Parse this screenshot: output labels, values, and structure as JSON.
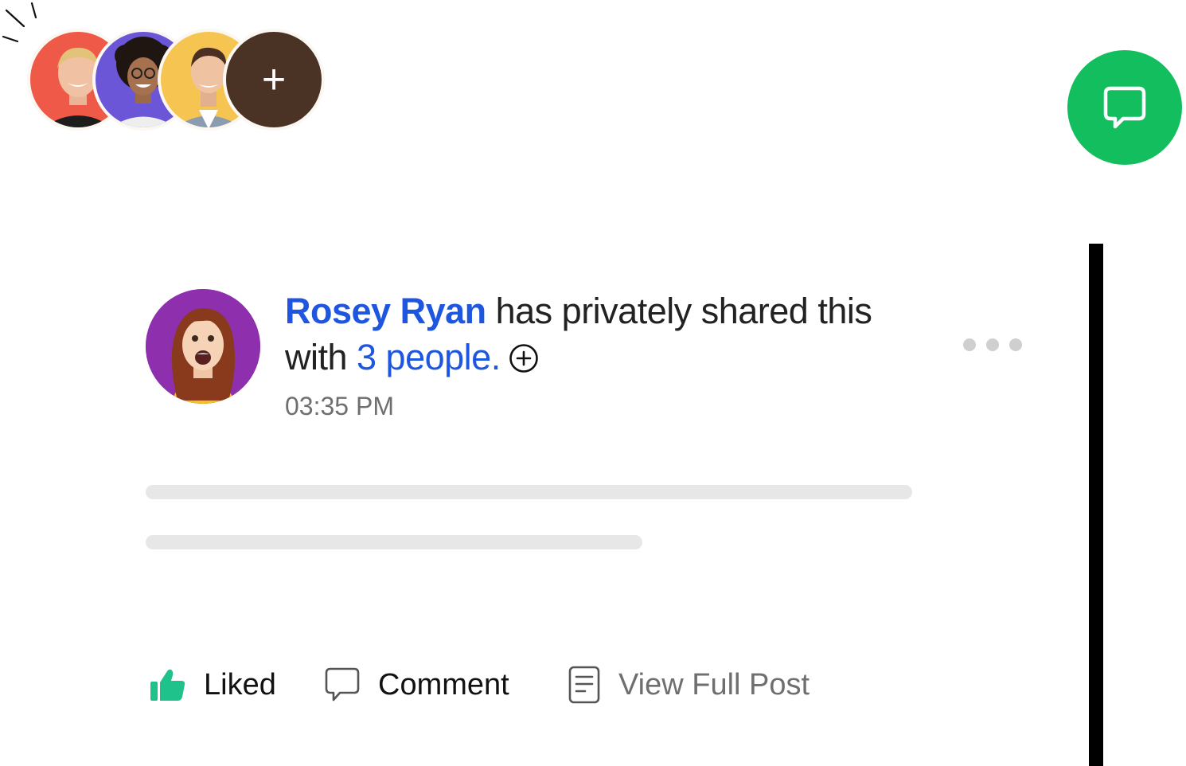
{
  "participants": {
    "avatars": [
      {
        "name": "participant-avatar-1",
        "bg": "#ef5a48"
      },
      {
        "name": "participant-avatar-2",
        "bg": "#6a56d6"
      },
      {
        "name": "participant-avatar-3",
        "bg": "#f6c451"
      }
    ],
    "add_label": "+",
    "add_bg": "#4a3224"
  },
  "chat_fab": {
    "icon": "chat-bubble-icon",
    "color": "#12be5d"
  },
  "post": {
    "author": "Rosey Ryan",
    "action_text": " has privately shared this with ",
    "people_link": "3 people.",
    "add_people_icon": "plus-circle-icon",
    "timestamp": "03:35 PM",
    "more_icon": "more-horizontal-icon",
    "link_color": "#1f56e0"
  },
  "actions": {
    "like": {
      "label": "Liked",
      "icon": "thumbs-up-icon",
      "color": "#1fc28a"
    },
    "comment": {
      "label": "Comment",
      "icon": "comment-icon"
    },
    "view_full": {
      "label": "View Full Post",
      "icon": "document-icon"
    }
  }
}
